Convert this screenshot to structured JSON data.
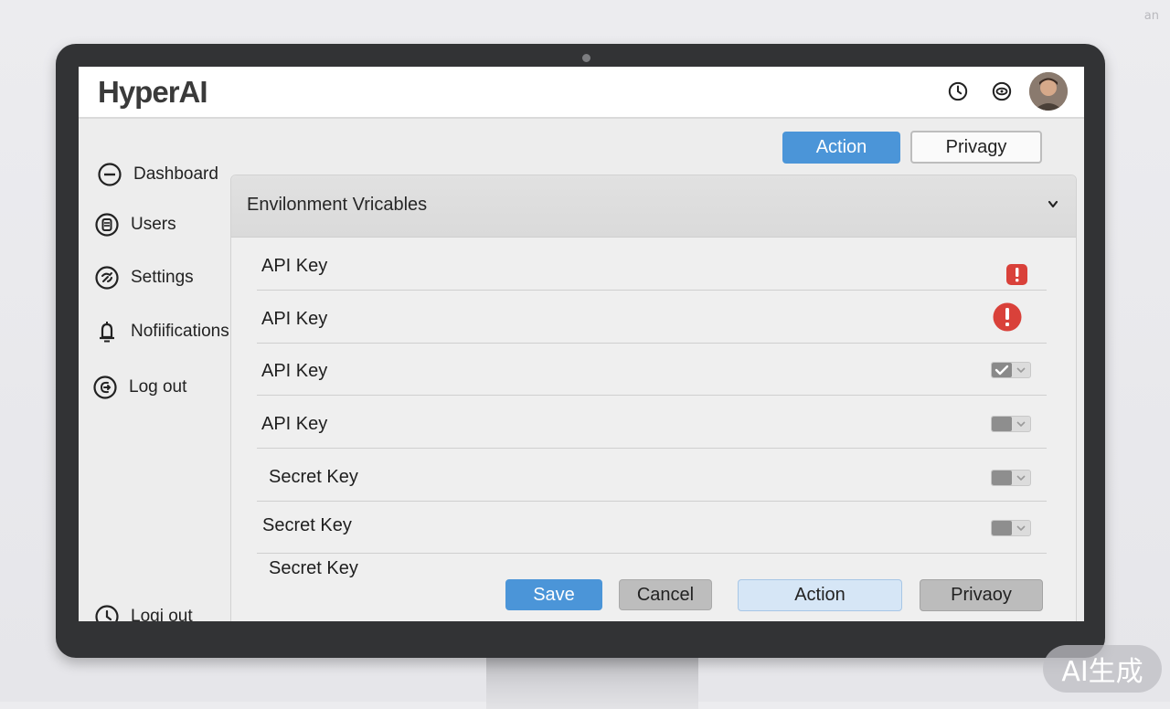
{
  "corner_text": "an",
  "app": {
    "brand": "HyperAI"
  },
  "header": {
    "icons": [
      "clock-icon",
      "eye-icon"
    ],
    "avatar": "user-avatar"
  },
  "sidebar": {
    "items": [
      {
        "label": "Dashboard",
        "icon": "dashboard-icon"
      },
      {
        "label": "Users",
        "icon": "users-icon"
      },
      {
        "label": "Settings",
        "icon": "settings-icon"
      },
      {
        "label": "Nofiifications",
        "icon": "bell-icon"
      },
      {
        "label": "Log out",
        "icon": "logout-icon"
      }
    ],
    "bottom_item": {
      "label": "Logi out",
      "icon": "logout-icon"
    }
  },
  "top_actions": {
    "action_label": "Action",
    "privacy_label": "Privagy"
  },
  "panel": {
    "title": "Envilonment Vricables",
    "rows": [
      {
        "label": "API Key",
        "status": "error-badge-square"
      },
      {
        "label": "API Key",
        "status": "error-badge-circle"
      },
      {
        "label": "API Key",
        "status": "toggle-checked"
      },
      {
        "label": "API Key",
        "status": "toggle"
      },
      {
        "label": "Secret Key",
        "status": "toggle"
      },
      {
        "label": "Secret Key",
        "status": "toggle"
      },
      {
        "label": "Secret Key",
        "status": "none"
      }
    ]
  },
  "footer_actions": {
    "save_label": "Save",
    "cancel_label": "Cancel",
    "action_label": "Action",
    "privacy_label": "Privaoy"
  },
  "watermark": "AI生成",
  "colors": {
    "primary": "#4b95d8",
    "error": "#d9413a",
    "bezel": "#323335"
  }
}
